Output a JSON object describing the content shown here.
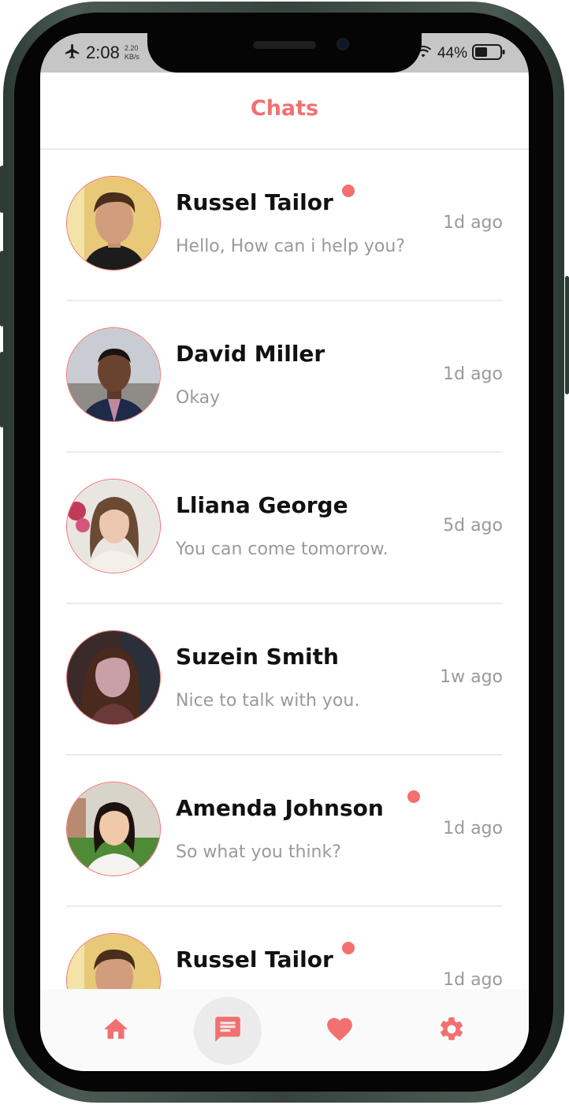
{
  "status_bar": {
    "time": "2:08",
    "data_rate_value": "2.20",
    "data_rate_unit": "KB/s",
    "battery_percent": "44%",
    "icons": [
      "airplane-icon",
      "wifi-icon",
      "battery-icon"
    ]
  },
  "header": {
    "title": "Chats"
  },
  "colors": {
    "accent": "#f37070",
    "muted_text": "#9a9a9a",
    "name_text": "#111111",
    "divider": "#ececec",
    "nav_active_bg": "#ebebeb"
  },
  "chats": [
    {
      "name": "Russel Tailor",
      "message": "Hello, How can i help you?",
      "time": "1d ago",
      "unread": true
    },
    {
      "name": "David Miller",
      "message": "Okay",
      "time": "1d ago",
      "unread": false
    },
    {
      "name": "Lliana George",
      "message": "You can come tomorrow.",
      "time": "5d ago",
      "unread": false
    },
    {
      "name": "Suzein Smith",
      "message": "Nice to talk with you.",
      "time": "1w ago",
      "unread": false
    },
    {
      "name": "Amenda Johnson",
      "message": "So what you think?",
      "time": "1d ago",
      "unread": true
    },
    {
      "name": "Russel Tailor",
      "message": "",
      "time": "1d ago",
      "unread": true
    }
  ],
  "bottom_nav": {
    "items": [
      {
        "icon": "home-icon",
        "active": false
      },
      {
        "icon": "chat-icon",
        "active": true
      },
      {
        "icon": "heart-icon",
        "active": false
      },
      {
        "icon": "settings-icon",
        "active": false
      }
    ]
  }
}
